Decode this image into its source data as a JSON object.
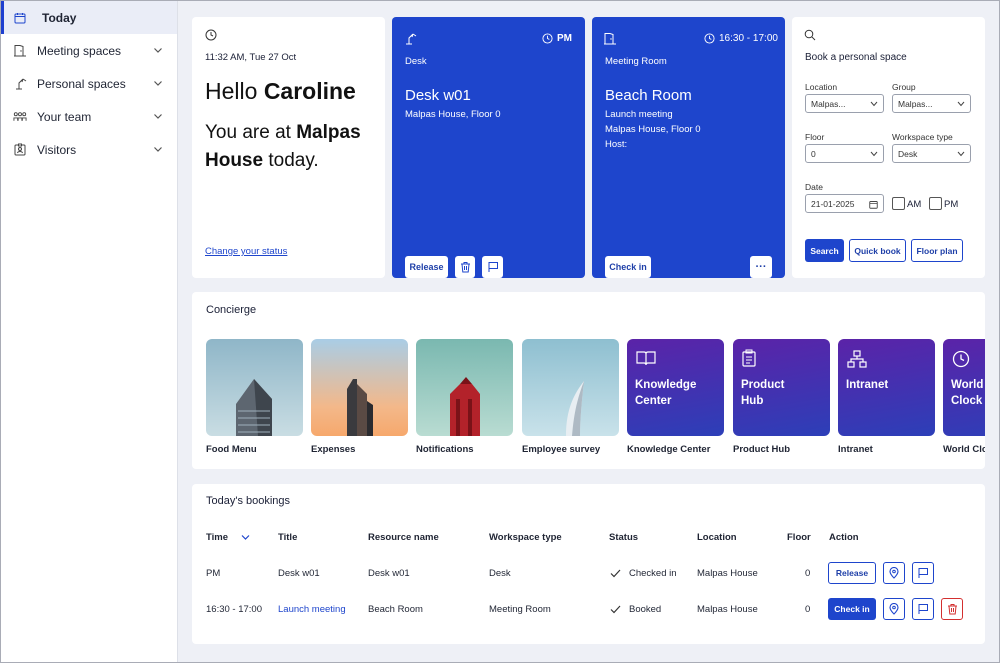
{
  "sidebar": {
    "items": [
      {
        "label": "Today",
        "icon": "calendar-icon"
      },
      {
        "label": "Meeting spaces",
        "icon": "door-icon"
      },
      {
        "label": "Personal spaces",
        "icon": "desk-lamp-icon"
      },
      {
        "label": "Your team",
        "icon": "team-icon"
      },
      {
        "label": "Visitors",
        "icon": "visitor-badge-icon"
      }
    ]
  },
  "welcome": {
    "datetime": "11:32 AM, Tue 27 Oct",
    "greeting": "Hello",
    "name": "Caroline",
    "you_are_at": "You are at",
    "location": "Malpas",
    "location2": "House",
    "today": "today.",
    "change_status": "Change your status"
  },
  "desk_card": {
    "time": "PM",
    "type": "Desk",
    "title": "Desk w01",
    "subtitle": "Malpas House, Floor 0",
    "release_label": "Release"
  },
  "room_card": {
    "time": "16:30 - 17:00",
    "type": "Meeting Room",
    "title": "Beach Room",
    "line1": "Launch meeting",
    "line2": "Malpas House, Floor 0",
    "line3": "Host:",
    "checkin_label": "Check in",
    "more_label": "···"
  },
  "booking_form": {
    "title": "Book a personal space",
    "location_label": "Location",
    "location_value": "Malpas...",
    "group_label": "Group",
    "group_value": "Malpas...",
    "floor_label": "Floor",
    "floor_value": "0",
    "workspace_label": "Workspace type",
    "workspace_value": "Desk",
    "date_label": "Date",
    "date_value": "21-01-2025",
    "am_label": "AM",
    "pm_label": "PM",
    "search_label": "Search",
    "quickbook_label": "Quick book",
    "floorplan_label": "Floor plan"
  },
  "concierge": {
    "title": "Concierge",
    "tiles": [
      {
        "label": "Food Menu"
      },
      {
        "label": "Expenses"
      },
      {
        "label": "Notifications"
      },
      {
        "label": "Employee survey"
      },
      {
        "label": "Knowledge Center",
        "text1": "Knowledge",
        "text2": "Center"
      },
      {
        "label": "Product Hub",
        "text1": "Product",
        "text2": "Hub"
      },
      {
        "label": "Intranet",
        "text1": "Intranet",
        "text2": ""
      },
      {
        "label": "World Clock",
        "text1": "World",
        "text2": "Clock"
      }
    ]
  },
  "bookings": {
    "title": "Today's bookings",
    "columns": [
      "Time",
      "Title",
      "Resource name",
      "Workspace type",
      "Status",
      "Location",
      "Floor",
      "Action"
    ],
    "rows": [
      {
        "time": "PM",
        "title": "Desk w01",
        "resource": "Desk w01",
        "workspace": "Desk",
        "status": "Checked in",
        "location": "Malpas House",
        "floor": "0",
        "action": "Release"
      },
      {
        "time": "16:30 - 17:00",
        "title": "Launch meeting",
        "resource": "Beach Room",
        "workspace": "Meeting Room",
        "status": "Booked",
        "location": "Malpas House",
        "floor": "0",
        "action": "Check in"
      }
    ]
  },
  "colors": {
    "primary": "#1e45cc",
    "danger": "#d32f2f",
    "background": "#eef0f6"
  }
}
